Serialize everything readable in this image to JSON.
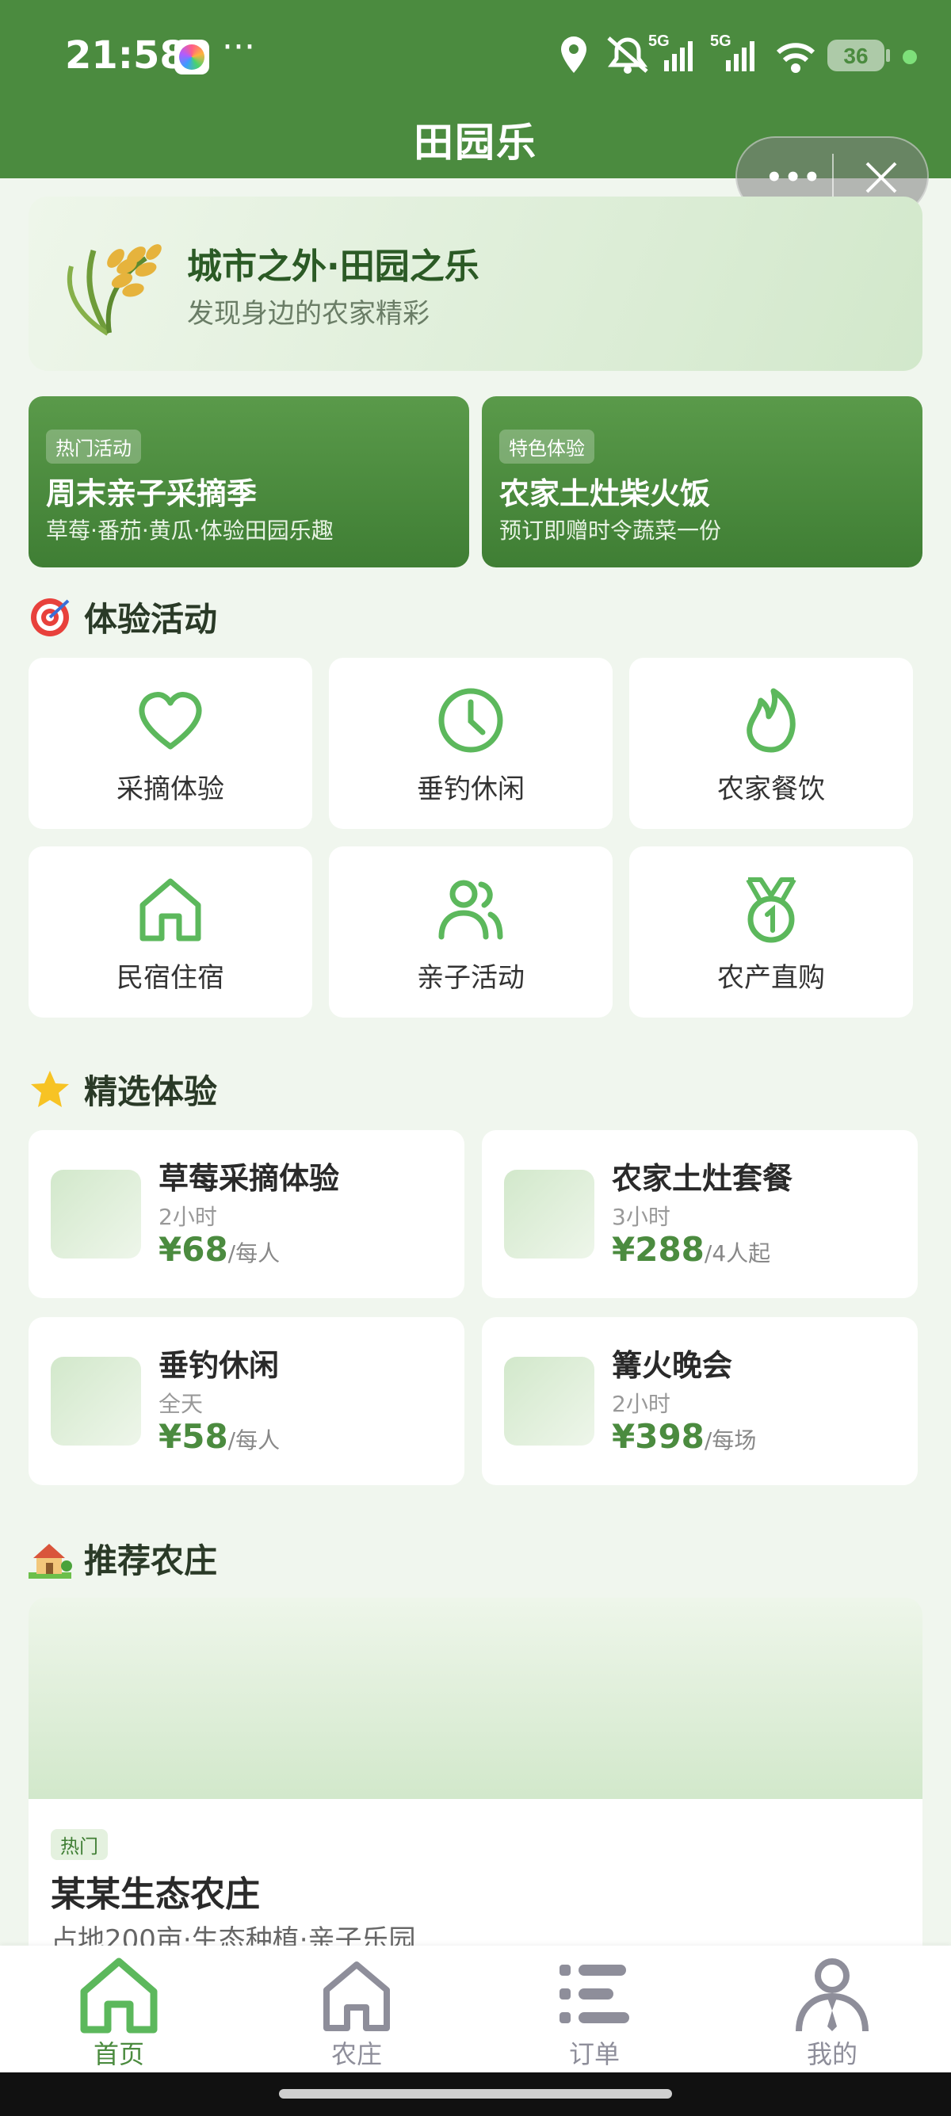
{
  "status_bar": {
    "time": "21:58",
    "more": "···",
    "network_1": "5G",
    "network_2": "5G",
    "battery": "36"
  },
  "header": {
    "title": "田园乐"
  },
  "banner": {
    "title": "城市之外·田园之乐",
    "subtitle": "发现身边的农家精彩"
  },
  "promos": [
    {
      "tag": "热门活动",
      "title": "周末亲子采摘季",
      "subtitle": "草莓·番茄·黄瓜·体验田园乐趣"
    },
    {
      "tag": "特色体验",
      "title": "农家土灶柴火饭",
      "subtitle": "预订即赠时令蔬菜一份"
    }
  ],
  "activities_section": {
    "title": "体验活动",
    "icon": "target-icon"
  },
  "activities": [
    {
      "label": "采摘体验",
      "icon": "heart-icon"
    },
    {
      "label": "垂钓休闲",
      "icon": "clock-icon"
    },
    {
      "label": "农家餐饮",
      "icon": "flame-icon"
    },
    {
      "label": "民宿住宿",
      "icon": "house-icon"
    },
    {
      "label": "亲子活动",
      "icon": "people-icon"
    },
    {
      "label": "农产直购",
      "icon": "medal-icon"
    }
  ],
  "featured_section": {
    "title": "精选体验",
    "icon": "star-icon"
  },
  "featured": [
    {
      "name": "草莓采摘体验",
      "duration": "2小时",
      "price": "¥68",
      "unit": "/每人"
    },
    {
      "name": "农家土灶套餐",
      "duration": "3小时",
      "price": "¥288",
      "unit": "/4人起"
    },
    {
      "name": "垂钓休闲",
      "duration": "全天",
      "price": "¥58",
      "unit": "/每人"
    },
    {
      "name": "篝火晚会",
      "duration": "2小时",
      "price": "¥398",
      "unit": "/每场"
    }
  ],
  "farms_section": {
    "title": "推荐农庄",
    "icon": "farmhouse-icon"
  },
  "farm": {
    "tag": "热门",
    "name": "某某生态农庄",
    "desc": "占地200亩·生态种植·亲子乐园"
  },
  "tabs": [
    {
      "label": "首页",
      "icon": "home-icon",
      "active": true
    },
    {
      "label": "农庄",
      "icon": "farm-icon",
      "active": false
    },
    {
      "label": "订单",
      "icon": "list-icon",
      "active": false
    },
    {
      "label": "我的",
      "icon": "user-icon",
      "active": false
    }
  ],
  "colors": {
    "primary": "#4b8b3f",
    "accent": "#5cb85c",
    "inactive": "#8e8e9a"
  }
}
